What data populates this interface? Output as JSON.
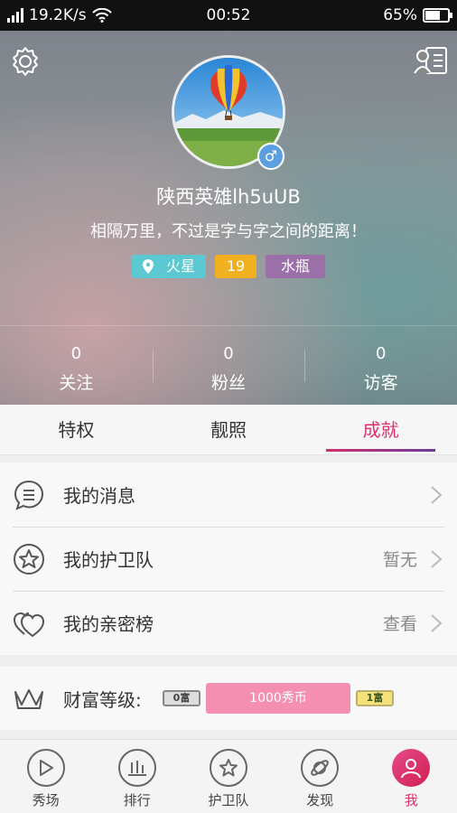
{
  "status_bar": {
    "speed": "19.2K/s",
    "time": "00:52",
    "battery": "65%",
    "battery_level": 0.65
  },
  "profile": {
    "username": "陕西英雄lh5uUB",
    "signature": "相隔万里，不过是字与字之间的距离！",
    "gender_symbol": "♂",
    "tags": {
      "location": "火星",
      "age": "19",
      "zodiac": "水瓶"
    },
    "stats": [
      {
        "count": "0",
        "label": "关注"
      },
      {
        "count": "0",
        "label": "粉丝"
      },
      {
        "count": "0",
        "label": "访客"
      }
    ]
  },
  "tabs": [
    {
      "label": "特权"
    },
    {
      "label": "靓照"
    },
    {
      "label": "成就"
    }
  ],
  "list": [
    {
      "label": "我的消息",
      "value": ""
    },
    {
      "label": "我的护卫队",
      "value": "暂无"
    },
    {
      "label": "我的亲密榜",
      "value": "查看"
    }
  ],
  "wealth": {
    "label": "财富等级:",
    "current_level": "0富",
    "bar_text": "1000秀币",
    "next_level": "1富"
  },
  "bottom_nav": [
    {
      "label": "秀场"
    },
    {
      "label": "排行"
    },
    {
      "label": "护卫队"
    },
    {
      "label": "发现"
    },
    {
      "label": "我"
    }
  ],
  "colors": {
    "accent": "#e0306e",
    "tag_location": "#5bc8d2",
    "tag_age": "#f0b020",
    "tag_zodiac": "#9b6fa8",
    "wealth_bar": "#f48fb1"
  }
}
